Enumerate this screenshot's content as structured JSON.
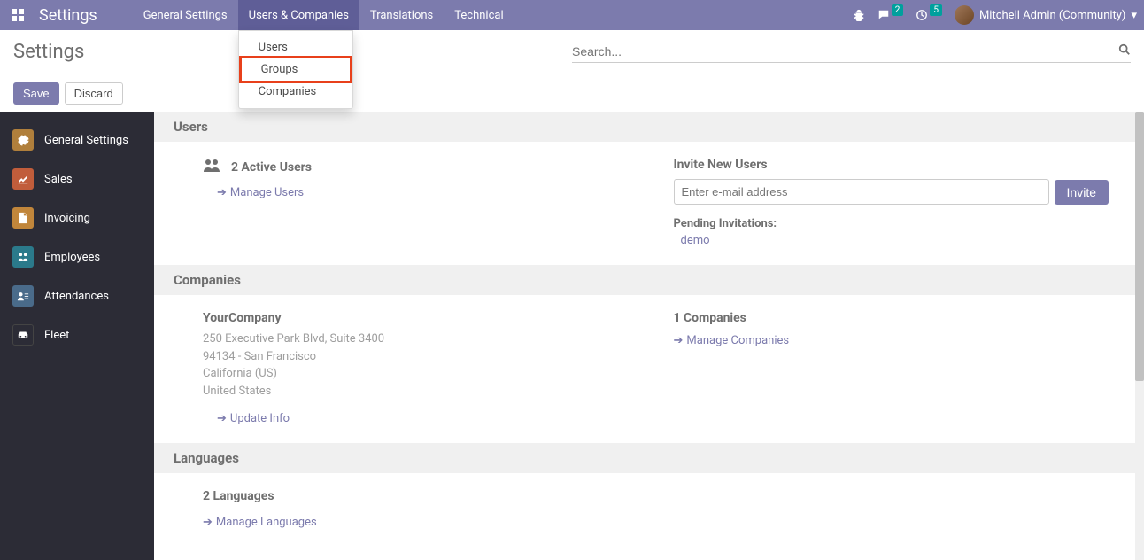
{
  "topbar": {
    "app_title": "Settings",
    "nav": [
      {
        "label": "General Settings"
      },
      {
        "label": "Users & Companies",
        "active": true
      },
      {
        "label": "Translations"
      },
      {
        "label": "Technical"
      }
    ],
    "dropdown": {
      "items": [
        "Users",
        "Groups",
        "Companies"
      ],
      "highlighted": "Groups"
    },
    "chat_badge": "2",
    "activity_badge": "5",
    "user_name": "Mitchell Admin (Community)"
  },
  "subheader": {
    "title": "Settings",
    "search_placeholder": "Search..."
  },
  "actions": {
    "save": "Save",
    "discard": "Discard"
  },
  "sidebar": {
    "items": [
      {
        "label": "General Settings",
        "icon": "gear",
        "bg": "#b07f3c"
      },
      {
        "label": "Sales",
        "icon": "chart",
        "bg": "#c15d3b"
      },
      {
        "label": "Invoicing",
        "icon": "file",
        "bg": "#c1863b"
      },
      {
        "label": "Employees",
        "icon": "people",
        "bg": "#2b7a8b"
      },
      {
        "label": "Attendances",
        "icon": "clock",
        "bg": "#4a6b8a"
      },
      {
        "label": "Fleet",
        "icon": "car",
        "bg": "#2c2c36"
      }
    ]
  },
  "content": {
    "users_section": {
      "header": "Users",
      "active_count": "2 Active Users",
      "manage_link": "Manage Users",
      "invite_title": "Invite New Users",
      "email_placeholder": "Enter e-mail address",
      "invite_btn": "Invite",
      "pending_label": "Pending Invitations:",
      "pending_items": [
        "demo"
      ]
    },
    "companies_section": {
      "header": "Companies",
      "company_name": "YourCompany",
      "address": [
        "250 Executive Park Blvd, Suite 3400",
        "94134 - San Francisco",
        "California (US)",
        "United States"
      ],
      "update_link": "Update Info",
      "count_label": "1 Companies",
      "manage_link": "Manage Companies"
    },
    "languages_section": {
      "header": "Languages",
      "count_label": "2 Languages",
      "manage_link": "Manage Languages"
    }
  }
}
